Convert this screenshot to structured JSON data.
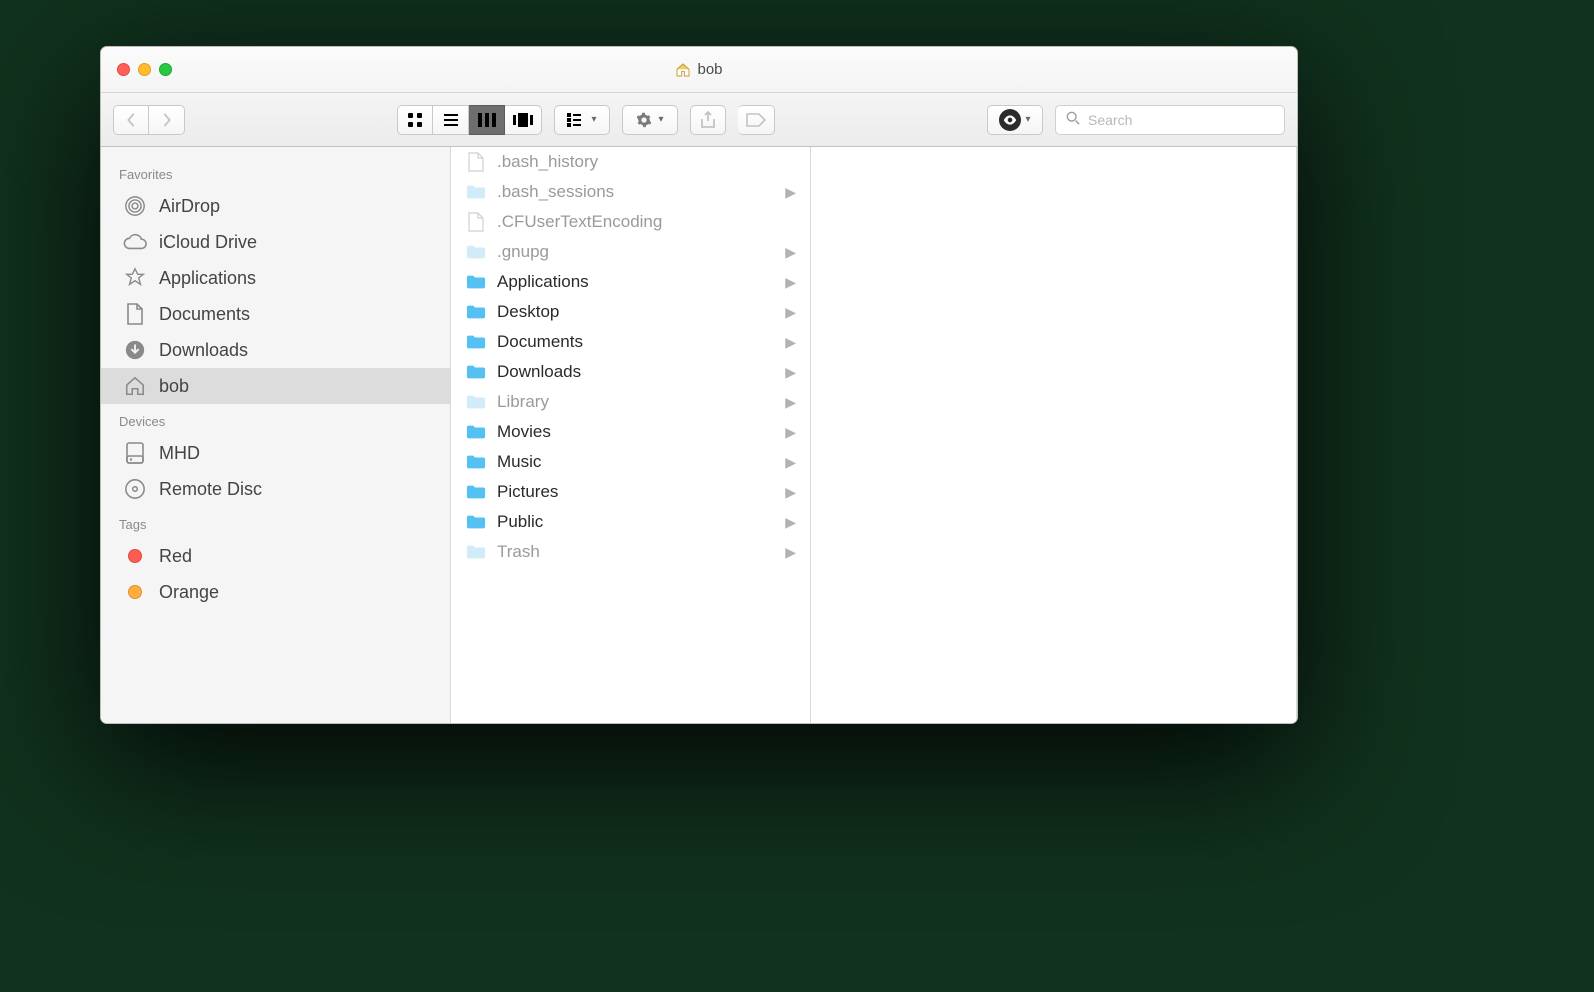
{
  "window": {
    "title": "bob"
  },
  "toolbar": {
    "search_placeholder": "Search"
  },
  "sidebar": {
    "sections": [
      {
        "heading": "Favorites",
        "items": [
          {
            "label": "AirDrop",
            "icon": "airdrop"
          },
          {
            "label": "iCloud Drive",
            "icon": "cloud"
          },
          {
            "label": "Applications",
            "icon": "apps"
          },
          {
            "label": "Documents",
            "icon": "doc"
          },
          {
            "label": "Downloads",
            "icon": "download"
          },
          {
            "label": "bob",
            "icon": "home",
            "selected": true
          }
        ]
      },
      {
        "heading": "Devices",
        "items": [
          {
            "label": "MHD",
            "icon": "disk"
          },
          {
            "label": "Remote Disc",
            "icon": "disc"
          }
        ]
      },
      {
        "heading": "Tags",
        "items": [
          {
            "label": "Red",
            "icon": "tag",
            "color": "#ff5b52"
          },
          {
            "label": "Orange",
            "icon": "tag",
            "color": "#ffad3b"
          }
        ]
      }
    ]
  },
  "column": {
    "items": [
      {
        "name": ".bash_history",
        "type": "file",
        "dim": true
      },
      {
        "name": ".bash_sessions",
        "type": "folder",
        "dim": true,
        "chevron": true
      },
      {
        "name": ".CFUserTextEncoding",
        "type": "file",
        "dim": true
      },
      {
        "name": ".gnupg",
        "type": "folder",
        "dim": true,
        "chevron": true
      },
      {
        "name": "Applications",
        "type": "folder",
        "chevron": true
      },
      {
        "name": "Desktop",
        "type": "folder",
        "chevron": true
      },
      {
        "name": "Documents",
        "type": "folder",
        "chevron": true
      },
      {
        "name": "Downloads",
        "type": "folder",
        "chevron": true
      },
      {
        "name": "Library",
        "type": "folder",
        "dim": true,
        "chevron": true
      },
      {
        "name": "Movies",
        "type": "folder",
        "chevron": true
      },
      {
        "name": "Music",
        "type": "folder",
        "chevron": true
      },
      {
        "name": "Pictures",
        "type": "folder",
        "chevron": true
      },
      {
        "name": "Public",
        "type": "folder",
        "chevron": true
      },
      {
        "name": "Trash",
        "type": "folder",
        "dim": true,
        "chevron": true
      }
    ]
  }
}
